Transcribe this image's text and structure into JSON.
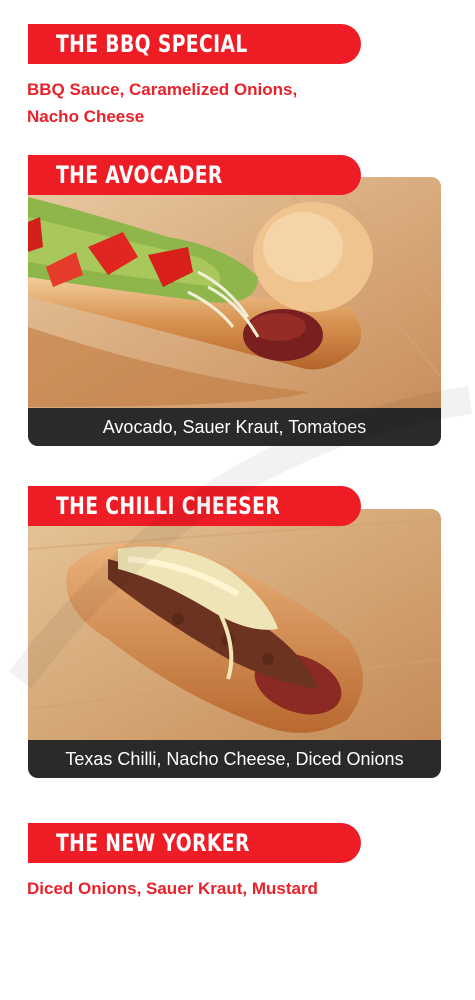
{
  "items": [
    {
      "title": "THE BBQ SPECIAL",
      "description": "BBQ Sauce, Caramelized Onions,\nNacho Cheese"
    },
    {
      "title": "THE AVOCADER",
      "caption": "Avocado, Sauer Kraut, Tomatoes",
      "image": "avocado-hotdog-photo"
    },
    {
      "title": "THE CHILLI CHEESER",
      "caption": "Texas Chilli, Nacho Cheese, Diced Onions",
      "image": "chilli-cheese-hotdog-photo"
    },
    {
      "title": "THE NEW YORKER",
      "description": "Diced Onions, Sauer Kraut, Mustard"
    }
  ],
  "colors": {
    "banner": "#ee1c25",
    "description_text": "#e8212a",
    "caption_bar": "#2a2a2a"
  }
}
